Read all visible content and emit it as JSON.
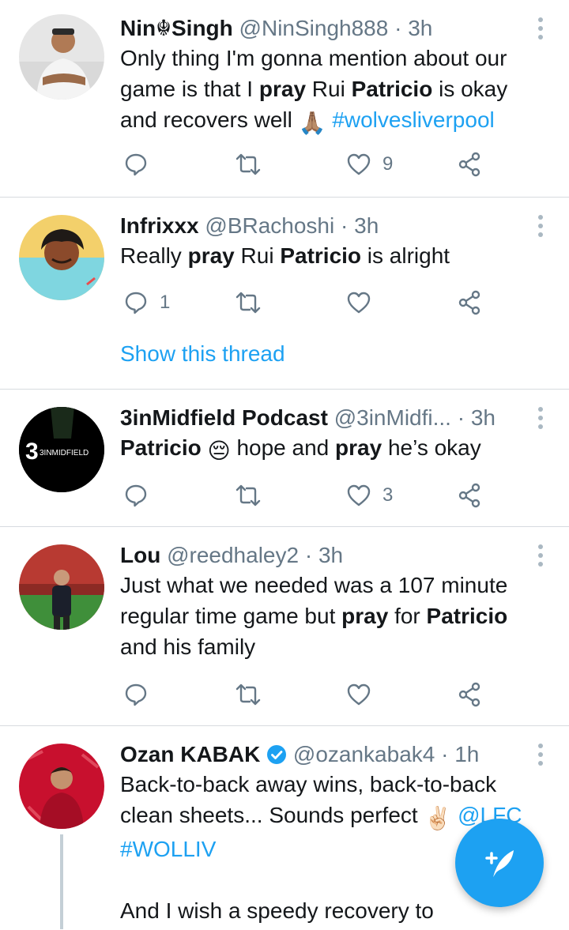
{
  "tweets": [
    {
      "name": "Nin☬Singh",
      "handle": "@NinSingh888",
      "time": "3h",
      "body": [
        "Only thing I'm gonna mention about our game is that I ",
        "pray",
        " Rui ",
        "Patricio",
        " is okay and recovers well ",
        "🙏🏽",
        " ",
        "#wolvesliverpool"
      ],
      "reply_count": "",
      "like_count": "9"
    },
    {
      "name": "Infrixxx",
      "handle": "@BRachoshi",
      "time": "3h",
      "body": [
        "Really ",
        "pray",
        " Rui ",
        "Patricio",
        " is alright"
      ],
      "reply_count": "1",
      "like_count": "",
      "show_thread": "Show this thread"
    },
    {
      "name": "3inMidfield Podcast",
      "handle": "@3inMidfi...",
      "time": "3h",
      "body": [
        "Patricio",
        " ",
        "😔",
        " hope and ",
        "pray",
        " he’s okay"
      ],
      "reply_count": "",
      "like_count": "3",
      "avatar_text": "3INMIDFIELD"
    },
    {
      "name": "Lou",
      "handle": "@reedhaley2",
      "time": "3h",
      "body": [
        "Just what we needed was a 107 minute regular time game but ",
        "pray",
        " for ",
        "Patricio",
        " and his family"
      ],
      "reply_count": "",
      "like_count": ""
    },
    {
      "name": "Ozan KABAK",
      "handle": "@ozankabak4",
      "time": "1h",
      "body": [
        "Back-to-back away wins, back-to-back clean sheets... Sounds perfect ",
        "✌🏻",
        " ",
        "@LFC",
        " ",
        "#WOLLIV",
        "",
        "And I wish a speedy recovery to"
      ],
      "verified": true
    }
  ],
  "separator": "·",
  "icons": [
    "reply-icon",
    "retweet-icon",
    "like-icon",
    "share-icon",
    "more-icon",
    "compose-icon",
    "verified-icon"
  ],
  "colors": {
    "accent": "#1da1f2",
    "secondary_text": "#657786",
    "divider": "#d7dbdf"
  }
}
